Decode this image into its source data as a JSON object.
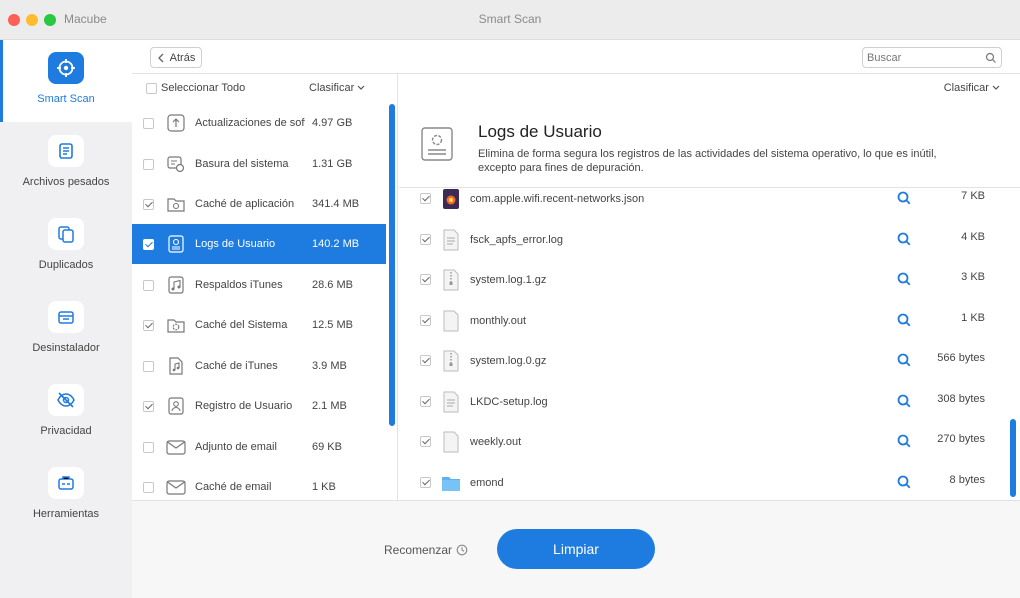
{
  "window": {
    "app_name": "Macube",
    "title": "Smart Scan"
  },
  "sidebar": {
    "items": [
      {
        "label": "Smart Scan",
        "icon": "target-icon",
        "active": true
      },
      {
        "label": "Archivos pesados",
        "icon": "document-icon",
        "active": false
      },
      {
        "label": "Duplicados",
        "icon": "duplicate-icon",
        "active": false
      },
      {
        "label": "Desinstalador",
        "icon": "uninstall-icon",
        "active": false
      },
      {
        "label": "Privacidad",
        "icon": "eye-off-icon",
        "active": false
      },
      {
        "label": "Herramientas",
        "icon": "toolbox-icon",
        "active": false
      }
    ]
  },
  "toolbar": {
    "back_label": "Atrás",
    "search_placeholder": "Buscar"
  },
  "left_panel": {
    "select_all_label": "Seleccionar Todo",
    "sort_label": "Clasificar",
    "categories": [
      {
        "name": "Actualizaciones de software",
        "size": "4.97 GB",
        "checked": false,
        "active": false,
        "icon": "upload-icon"
      },
      {
        "name": "Basura del sistema",
        "size": "1.31 GB",
        "checked": false,
        "active": false,
        "icon": "system-junk-icon"
      },
      {
        "name": "Caché de aplicación",
        "size": "341.4 MB",
        "checked": true,
        "active": false,
        "icon": "app-cache-icon"
      },
      {
        "name": "Logs de Usuario",
        "size": "140.2 MB",
        "checked": true,
        "active": true,
        "icon": "log-icon"
      },
      {
        "name": "Respaldos iTunes",
        "size": "28.6 MB",
        "checked": false,
        "active": false,
        "icon": "music-backup-icon"
      },
      {
        "name": "Caché del Sistema",
        "size": "12.5 MB",
        "checked": true,
        "active": false,
        "icon": "gear-folder-icon"
      },
      {
        "name": "Caché de iTunes",
        "size": "3.9 MB",
        "checked": false,
        "active": false,
        "icon": "music-note-icon"
      },
      {
        "name": "Registro de Usuario",
        "size": "2.1 MB",
        "checked": true,
        "active": false,
        "icon": "user-log-icon"
      },
      {
        "name": "Adjunto de email",
        "size": "69 KB",
        "checked": false,
        "active": false,
        "icon": "mail-icon"
      },
      {
        "name": "Caché de email",
        "size": "1 KB",
        "checked": false,
        "active": false,
        "icon": "mail-icon"
      }
    ]
  },
  "right_panel": {
    "sort_label": "Clasificar",
    "title": "Logs de Usuario",
    "description": "Elimina de forma segura los registros de las actividades del sistema operativo, lo que es inútil, excepto para fines de depuración.",
    "files": [
      {
        "name": "com.apple.wifi.recent-networks.json",
        "size": "7 KB",
        "checked": true,
        "icon": "json-file-icon"
      },
      {
        "name": "fsck_apfs_error.log",
        "size": "4 KB",
        "checked": true,
        "icon": "log-file-icon"
      },
      {
        "name": "system.log.1.gz",
        "size": "3 KB",
        "checked": true,
        "icon": "archive-file-icon"
      },
      {
        "name": "monthly.out",
        "size": "1 KB",
        "checked": true,
        "icon": "blank-file-icon"
      },
      {
        "name": "system.log.0.gz",
        "size": "566 bytes",
        "checked": true,
        "icon": "archive-file-icon"
      },
      {
        "name": "LKDC-setup.log",
        "size": "308 bytes",
        "checked": true,
        "icon": "log-file-icon"
      },
      {
        "name": "weekly.out",
        "size": "270 bytes",
        "checked": true,
        "icon": "blank-file-icon"
      },
      {
        "name": "emond",
        "size": "8 bytes",
        "checked": true,
        "icon": "folder-icon"
      }
    ]
  },
  "footer": {
    "restart_label": "Recomenzar",
    "clean_label": "Limpiar"
  },
  "colors": {
    "accent": "#1e7be0",
    "sidebar_bg": "#f0f0f2"
  }
}
